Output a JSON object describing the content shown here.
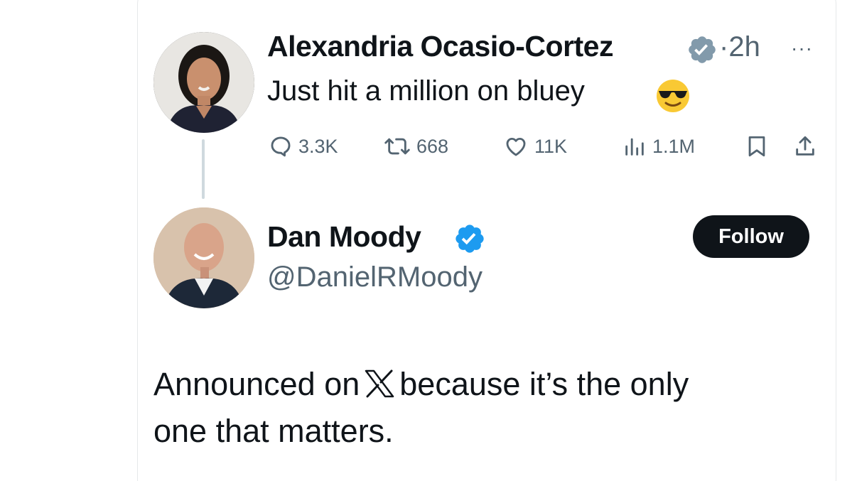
{
  "colors": {
    "text_primary": "#0f1419",
    "text_secondary": "#536471",
    "verified_blue": "#1d9bf0",
    "verified_gray": "#829aab",
    "follow_bg": "#0f1419",
    "follow_text": "#ffffff",
    "thread_line": "#cfd9de"
  },
  "parent_tweet": {
    "author_name": "Alexandria Ocasio-Cortez",
    "verified_icon": "gray-verified-badge-icon",
    "timestamp": "·2h",
    "more_icon": "more-options-icon",
    "text": "Just hit a million on bluey",
    "emoji": "smiling-face-with-sunglasses-emoji",
    "actions": {
      "reply": {
        "icon": "reply-icon",
        "count": "3.3K"
      },
      "repost": {
        "icon": "repost-icon",
        "count": "668"
      },
      "like": {
        "icon": "heart-icon",
        "count": "11K"
      },
      "views": {
        "icon": "views-chart-icon",
        "count": "1.1M"
      },
      "bookmark": {
        "icon": "bookmark-icon"
      },
      "share": {
        "icon": "share-icon"
      }
    }
  },
  "reply_tweet": {
    "author_name": "Dan Moody",
    "verified_icon": "blue-verified-badge-icon",
    "handle": "@DanielRMoody",
    "follow_label": "Follow",
    "text_line1_before": "Announced on",
    "x_logo_icon": "x-logo-icon",
    "text_line1_after": "because it’s the only",
    "text_line2": "one that matters."
  }
}
